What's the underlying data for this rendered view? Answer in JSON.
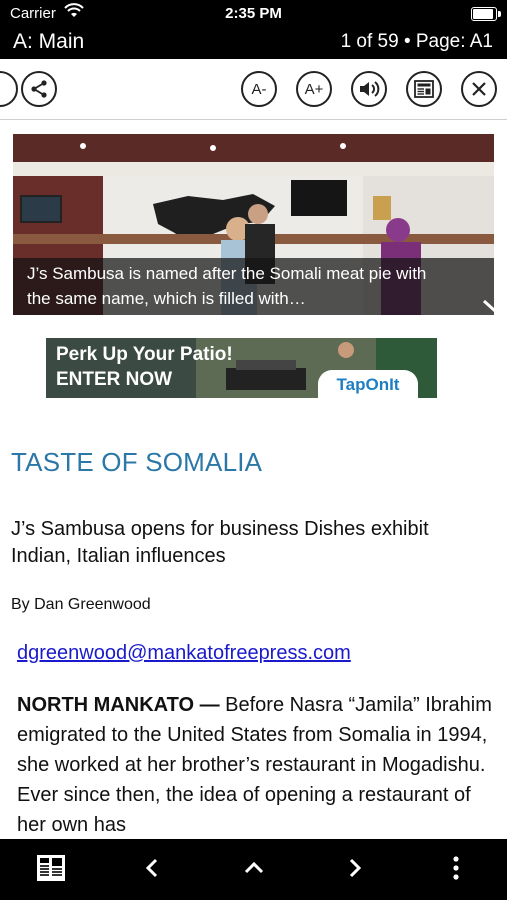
{
  "status_bar": {
    "carrier": "Carrier",
    "time": "2:35 PM"
  },
  "title_bar": {
    "section": "A: Main",
    "page_info": "1 of 59 • Page: A1"
  },
  "toolbar": {
    "share_icon": "share-icon",
    "font_decrease_label": "A-",
    "font_increase_label": "A+",
    "audio_icon": "speaker-icon",
    "page_view_icon": "newspaper-icon",
    "close_icon": "close-icon"
  },
  "photo": {
    "caption": "J’s Sambusa is named after the Somali meat pie with the same name, which is filled with…"
  },
  "ad": {
    "line1": "Perk Up Your Patio!",
    "line2": "ENTER NOW",
    "brand": "TapOnIt"
  },
  "article": {
    "headline": "TASTE OF SOMALIA",
    "subhead": "J’s Sambusa opens for business Dishes exhibit Indian, Italian influences",
    "byline": "By Dan Greenwood",
    "email": "dgreenwood@mankatofreepress.com",
    "dateline": "NORTH MANKATO —",
    "body": " Before Nasra “Jamila” Ibrahim emigrated to the United States from Somalia in 1994, she worked at her brother’s restaurant in Mogadishu. Ever since then, the idea of opening a restaurant of her own has"
  },
  "bottom_bar": {
    "icons": [
      "pages-icon",
      "chevron-left-icon",
      "chevron-up-icon",
      "chevron-right-icon",
      "more-vertical-icon"
    ]
  },
  "colors": {
    "headline": "#2b77a8",
    "link": "#1a1acc",
    "bars": "#000000"
  }
}
